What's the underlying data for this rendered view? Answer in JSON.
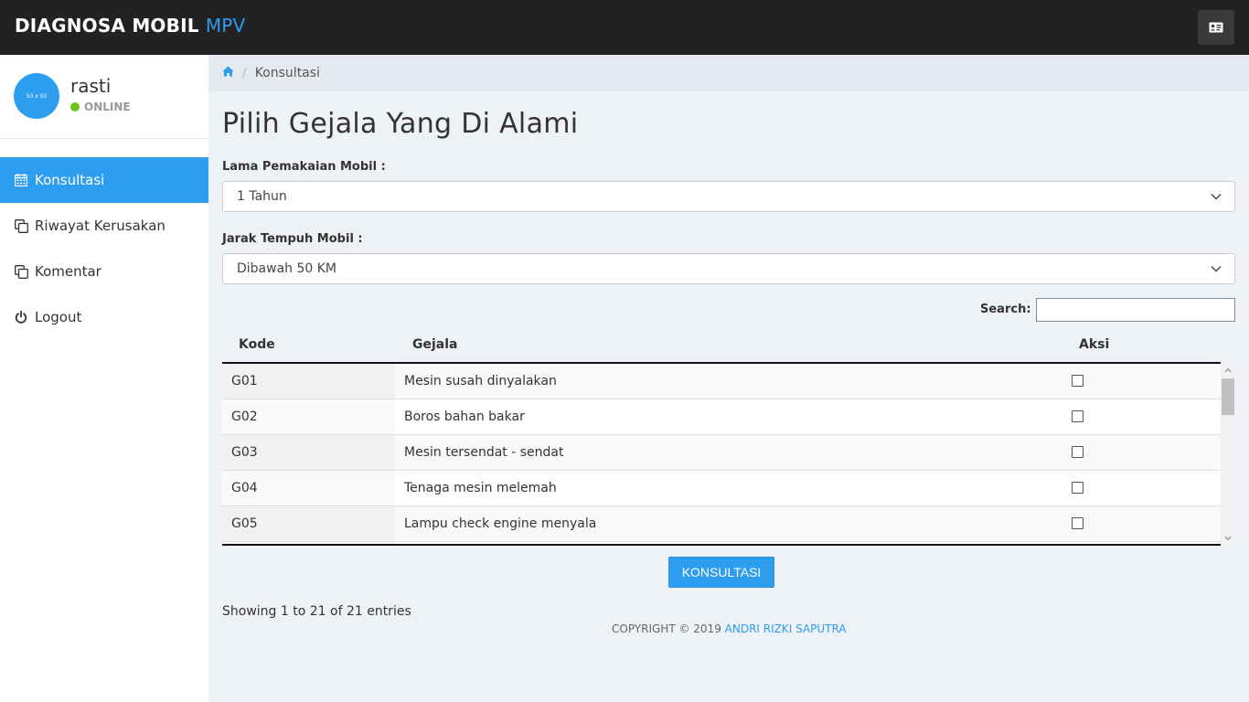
{
  "header": {
    "brand_main": "DIAGNOSA MOBIL",
    "brand_accent": "MPV",
    "profile_button_icon": "id-card-icon"
  },
  "sidebar": {
    "avatar_text": "50 x 50",
    "username": "rasti",
    "status": "ONLINE",
    "items": [
      {
        "label": "Konsultasi",
        "icon": "calendar-icon",
        "active": true
      },
      {
        "label": "Riwayat Kerusakan",
        "icon": "copy-icon",
        "active": false
      },
      {
        "label": "Komentar",
        "icon": "copy-icon",
        "active": false
      },
      {
        "label": "Logout",
        "icon": "power-icon",
        "active": false
      }
    ]
  },
  "breadcrumb": {
    "home_icon": "home-icon",
    "current": "Konsultasi"
  },
  "page": {
    "title": "Pilih Gejala Yang Di Alami",
    "lama_label": "Lama Pemakaian Mobil :",
    "lama_value": "1 Tahun",
    "jarak_label": "Jarak Tempuh Mobil :",
    "jarak_value": "Dibawah 50 KM",
    "search_label": "Search:",
    "search_value": ""
  },
  "table": {
    "columns": [
      "Kode",
      "Gejala",
      "Aksi"
    ],
    "rows": [
      {
        "kode": "G01",
        "gejala": "Mesin susah dinyalakan",
        "checked": false
      },
      {
        "kode": "G02",
        "gejala": "Boros bahan bakar",
        "checked": false
      },
      {
        "kode": "G03",
        "gejala": "Mesin tersendat - sendat",
        "checked": false
      },
      {
        "kode": "G04",
        "gejala": "Tenaga mesin melemah",
        "checked": false
      },
      {
        "kode": "G05",
        "gejala": "Lampu check engine menyala",
        "checked": false
      }
    ]
  },
  "actions": {
    "submit_label": "KONSULTASI"
  },
  "info": "Showing 1 to 21 of 21 entries",
  "footer": {
    "copyright": "COPYRIGHT © 2019",
    "author": "ANDRI RIZKI SAPUTRA"
  },
  "colors": {
    "accent": "#2d9df0",
    "topbar": "#222222",
    "online": "#6cc51d"
  }
}
